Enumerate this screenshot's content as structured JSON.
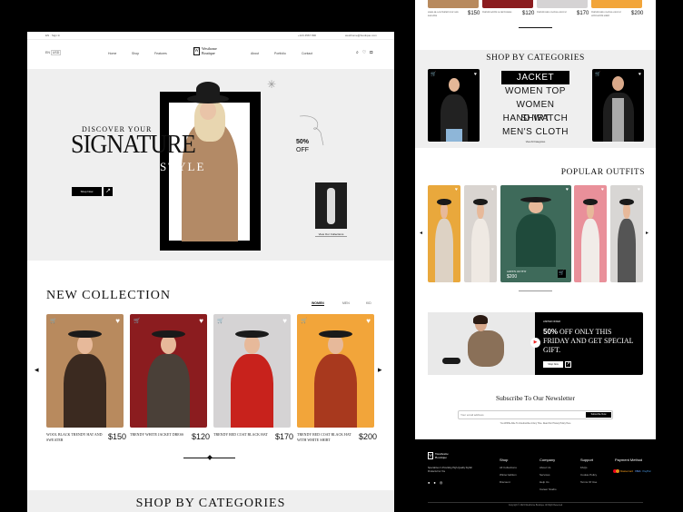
{
  "brand": {
    "name": "Westhome Boutique",
    "line1": "Westhome",
    "line2": "Boutique"
  },
  "topbar": {
    "left": "EN · Sign In",
    "phone": "+123 4567 890",
    "email": "westhome@boutique.com"
  },
  "nav": {
    "lang": "EN",
    "currency": "USD",
    "items": [
      "Home",
      "Shop",
      "Features",
      "About",
      "Portfolio",
      "Contact"
    ],
    "icons": [
      "search-icon",
      "heart-icon",
      "bag-icon"
    ]
  },
  "hero": {
    "discover": "DISCOVER YOUR",
    "signature": "SIGNATURE",
    "style": "STYLE",
    "cta": "Shop Now",
    "discount": "50%",
    "discount_label": "OFF",
    "collection_link": "View Our Collections",
    "bg": "#efefef"
  },
  "new_collection": {
    "title": "NEW  COLLECTION",
    "tabs": [
      "WOMEN",
      "MEN",
      "KID"
    ],
    "active_tab": "WOMEN",
    "products": [
      {
        "name": "Wool Black Trendy Hat and Sweater",
        "price": "$150",
        "color": "#b88a5e"
      },
      {
        "name": "Trendy White Jacket Dress",
        "price": "$120",
        "color": "#8b1c1f"
      },
      {
        "name": "Trendy Red Coat Black Hat",
        "price": "$170",
        "color": "#d5d3d4"
      },
      {
        "name": "Trendy Red Coat Black Hat With White Shirt",
        "price": "$200",
        "color": "#f2a53a"
      }
    ]
  },
  "categories": {
    "title": "SHOP BY CATEGORIES",
    "items": [
      "JACKET",
      "WOMEN TOP",
      "WOMEN SHIRT",
      "HAND WATCH",
      "MEN'S CLOTH"
    ],
    "active": "JACKET",
    "view_all": "View All Categories"
  },
  "popular": {
    "title": "POPULAR OUTFITS",
    "featured_name": "GREEN OUTFIT",
    "featured_price": "$200",
    "colors": [
      "#e9a83c",
      "#d9d4d0",
      "#3e6a5a",
      "#e9909a",
      "#d8d6d4"
    ]
  },
  "promo": {
    "eyebrow": "LIMITED OFFER",
    "headline_strong": "50%",
    "headline": " OFF ONLY THIS FRIDAY AND GET SPECIAL GIFT.",
    "cta": "Shop Now"
  },
  "newsletter": {
    "title": "Subscribe To Our Newsletter",
    "placeholder": "Your email address",
    "button": "Subscribe Now",
    "note": "You Will Be Able To Unsubscribe At Any Time. Read Our Privacy Policy Here"
  },
  "footer": {
    "about": "Specializes In Providing High-Quality Stylish Products For You",
    "columns": [
      {
        "title": "Shop",
        "links": [
          "All Collections",
          "Winter Edition",
          "Discount"
        ]
      },
      {
        "title": "Company",
        "links": [
          "About Us",
          "Services",
          "Help Us",
          "Career Studio"
        ]
      },
      {
        "title": "Support",
        "links": [
          "FAQs",
          "Cookie Policy",
          "Terms Of Use"
        ]
      }
    ],
    "payment_title": "Payment Method",
    "payments": [
      "Mastercard",
      "VISA",
      "PayPal"
    ],
    "copyright": "Copyright © 2024 Westhome Boutique. All Right Reserved"
  }
}
